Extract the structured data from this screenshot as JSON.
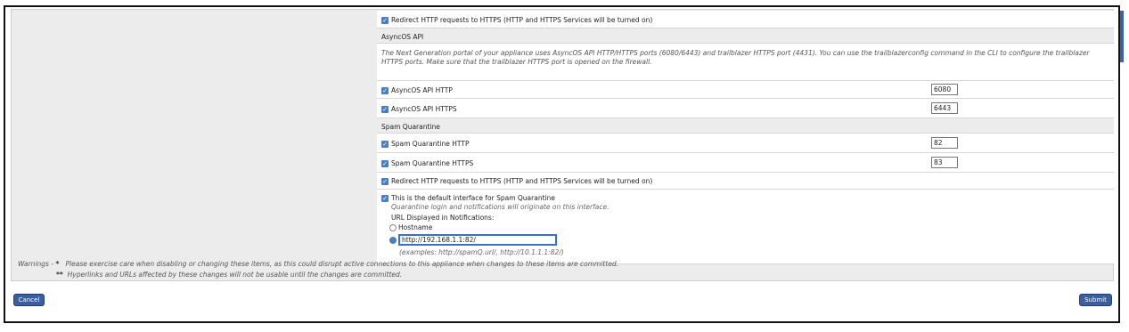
{
  "services": {
    "redirect_top_label": "Redirect HTTP requests to HTTPS (HTTP and HTTPS Services will be turned on)",
    "asyncos_section": "AsyncOS API",
    "asyncos_description": "The Next Generation portal of your appliance uses AsyncOS API HTTP/HTTPS ports (6080/6443) and trailblazer HTTPS port (4431). You can use the trailblazerconfig command in the CLI to configure the trailblazer HTTPS ports. Make sure that the trailblazer HTTPS port is opened on the firewall.",
    "asyncos_http_label": "AsyncOS API HTTP",
    "asyncos_http_port": "6080",
    "asyncos_https_label": "AsyncOS API HTTPS",
    "asyncos_https_port": "6443",
    "spam_section": "Spam Quarantine",
    "spam_http_label": "Spam Quarantine HTTP",
    "spam_http_port": "82",
    "spam_https_label": "Spam Quarantine HTTPS",
    "spam_https_port": "83",
    "redirect_bottom_label": "Redirect HTTP requests to HTTPS (HTTP and HTTPS Services will be turned on)",
    "default_interface_label": "This is the default interface for Spam Quarantine",
    "default_interface_note": "Quarantine login and notifications will originate on this interface.",
    "url_displayed_label": "URL Displayed in Notifications:",
    "hostname_option": "Hostname",
    "url_value": "http://192.168.1.1:82/",
    "url_examples": "(examples: http://spamQ.url/, http://10.1.1.1:82/)"
  },
  "warnings": {
    "label": "Warnings -",
    "star1": "*",
    "line1": "Please exercise care when disabling or changing these items, as this could disrupt active connections to this appliance when changes to these items are committed.",
    "star2": "**",
    "line2": "Hyperlinks and URLs affected by these changes will not be usable until the changes are committed."
  },
  "buttons": {
    "cancel": "Cancel",
    "submit": "Submit"
  },
  "colors": {
    "accent": "#3a5f9e",
    "checkbox": "#4a7fc4"
  }
}
